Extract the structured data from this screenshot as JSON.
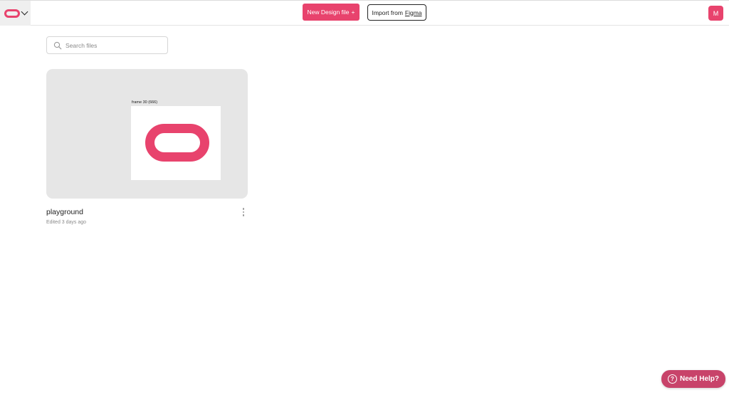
{
  "header": {
    "logo_icon": "app-logo-icon",
    "menu_icon": "chevron-down-icon",
    "new_design_label": "New Design file",
    "new_design_suffix": "+",
    "import_prefix": "Import from",
    "import_link": "Figma",
    "avatar_initial": "M",
    "accent_color": "#e8436d"
  },
  "search": {
    "placeholder": "Search files",
    "value": ""
  },
  "files": [
    {
      "name": "playground",
      "edited": "Edited 3 days ago",
      "thumbnail": {
        "frame_label": "frame 30 (666)"
      }
    }
  ],
  "help": {
    "label": "Need Help?",
    "icon": "?"
  }
}
